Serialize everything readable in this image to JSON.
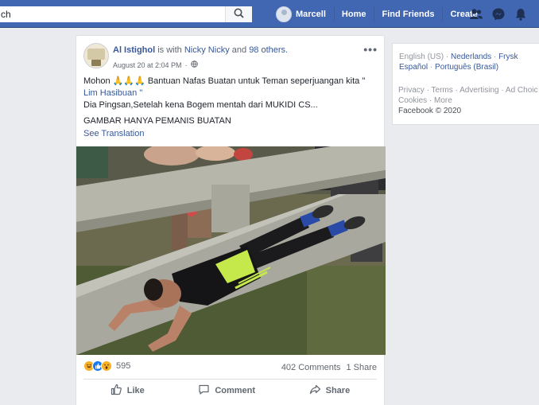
{
  "search": {
    "value": "ch"
  },
  "nav": {
    "user": "Marcell",
    "home": "Home",
    "find_friends": "Find Friends",
    "create": "Create"
  },
  "post": {
    "author": "Al Istighol",
    "is_with": "is with",
    "tagged": "Nicky Nicky",
    "and": "and",
    "others": "98 others.",
    "timestamp": "August 20 at 2:04 PM",
    "text_line1": "Mohon 🙏🙏🙏 Bantuan Nafas Buatan untuk Teman seperjuangan kita \"",
    "mention": "Lim Hasibuan \"",
    "text_line3": "Dia Pingsan,Setelah kena Bogem mentah dari MUKIDI CS...",
    "text_line4": "GAMBAR HANYA PEMANIS BUATAN",
    "see_translation": "See Translation",
    "reaction_count": "595",
    "comments": "402 Comments",
    "shares": "1 Share",
    "like": "Like",
    "comment": "Comment",
    "share": "Share"
  },
  "sidebar": {
    "current_lang": "English (US)",
    "lang1": "Nederlands",
    "lang2": "Frysk",
    "lang3": "Español",
    "lang4": "Português (Brasil)",
    "privacy": "Privacy",
    "terms": "Terms",
    "advertising": "Advertising",
    "ad_choices": "Ad Choic",
    "cookies": "Cookies",
    "more": "More",
    "copyright": "Facebook © 2020"
  },
  "colors": {
    "brand": "#4267b2",
    "link": "#385898"
  }
}
